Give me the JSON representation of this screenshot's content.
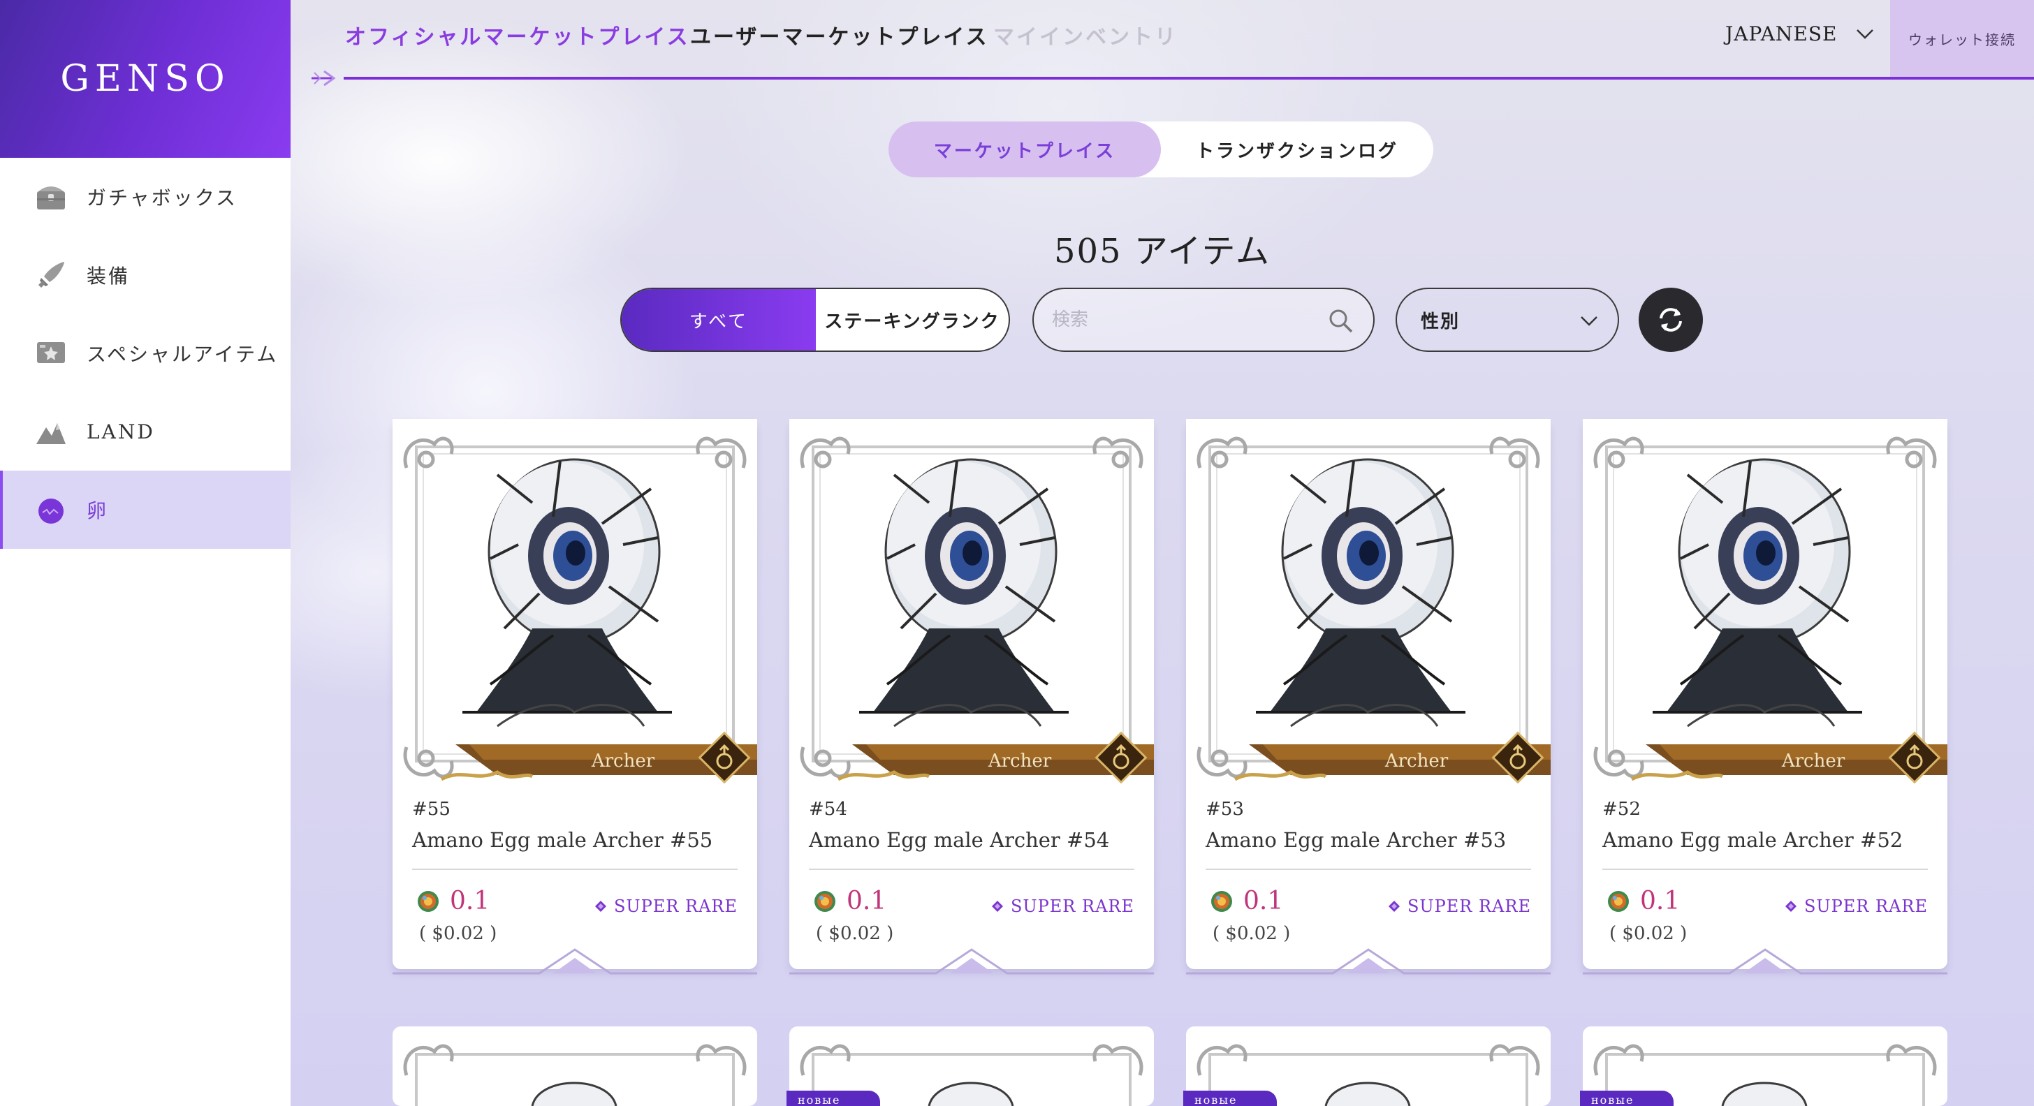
{
  "brand": {
    "logo": "GENSO"
  },
  "sidebar": {
    "items": [
      {
        "label": "ガチャボックス",
        "icon": "treasure-chest-icon"
      },
      {
        "label": "装備",
        "icon": "sword-icon"
      },
      {
        "label": "スペシャルアイテム",
        "icon": "special-item-icon"
      },
      {
        "label": "LAND",
        "icon": "mountain-icon"
      },
      {
        "label": "卵",
        "icon": "egg-icon",
        "active": true
      }
    ]
  },
  "topnav": {
    "tabs": [
      {
        "label": "オフィシャルマーケットプレイス",
        "state": "active"
      },
      {
        "label": "ユーザーマーケットプレイス",
        "state": "normal"
      },
      {
        "label": "マイインベントリ",
        "state": "disabled"
      }
    ],
    "language": "JAPANESE",
    "wallet_label": "ウォレット接続"
  },
  "segment": {
    "market": "マーケットプレイス",
    "log": "トランザクションログ"
  },
  "item_count": "505 アイテム",
  "filters": {
    "all": "すべて",
    "staking": "ステーキングランク",
    "search_placeholder": "検索",
    "gender": "性別"
  },
  "cards": [
    {
      "number": "#55",
      "name": "Amano Egg male Archer #55",
      "class": "Archer",
      "price": "0.1",
      "usd": "( $0.02 )",
      "rarity": "SUPER RARE"
    },
    {
      "number": "#54",
      "name": "Amano Egg male Archer #54",
      "class": "Archer",
      "price": "0.1",
      "usd": "( $0.02 )",
      "rarity": "SUPER RARE"
    },
    {
      "number": "#53",
      "name": "Amano Egg male Archer #53",
      "class": "Archer",
      "price": "0.1",
      "usd": "( $0.02 )",
      "rarity": "SUPER RARE"
    },
    {
      "number": "#52",
      "name": "Amano Egg male Archer #52",
      "class": "Archer",
      "price": "0.1",
      "usd": "( $0.02 )",
      "rarity": "SUPER RARE"
    }
  ],
  "next_row": {
    "badge": "новые"
  },
  "colors": {
    "accent": "#8a3ce0",
    "price": "#c0357a",
    "rarity": "#7b35cf"
  }
}
